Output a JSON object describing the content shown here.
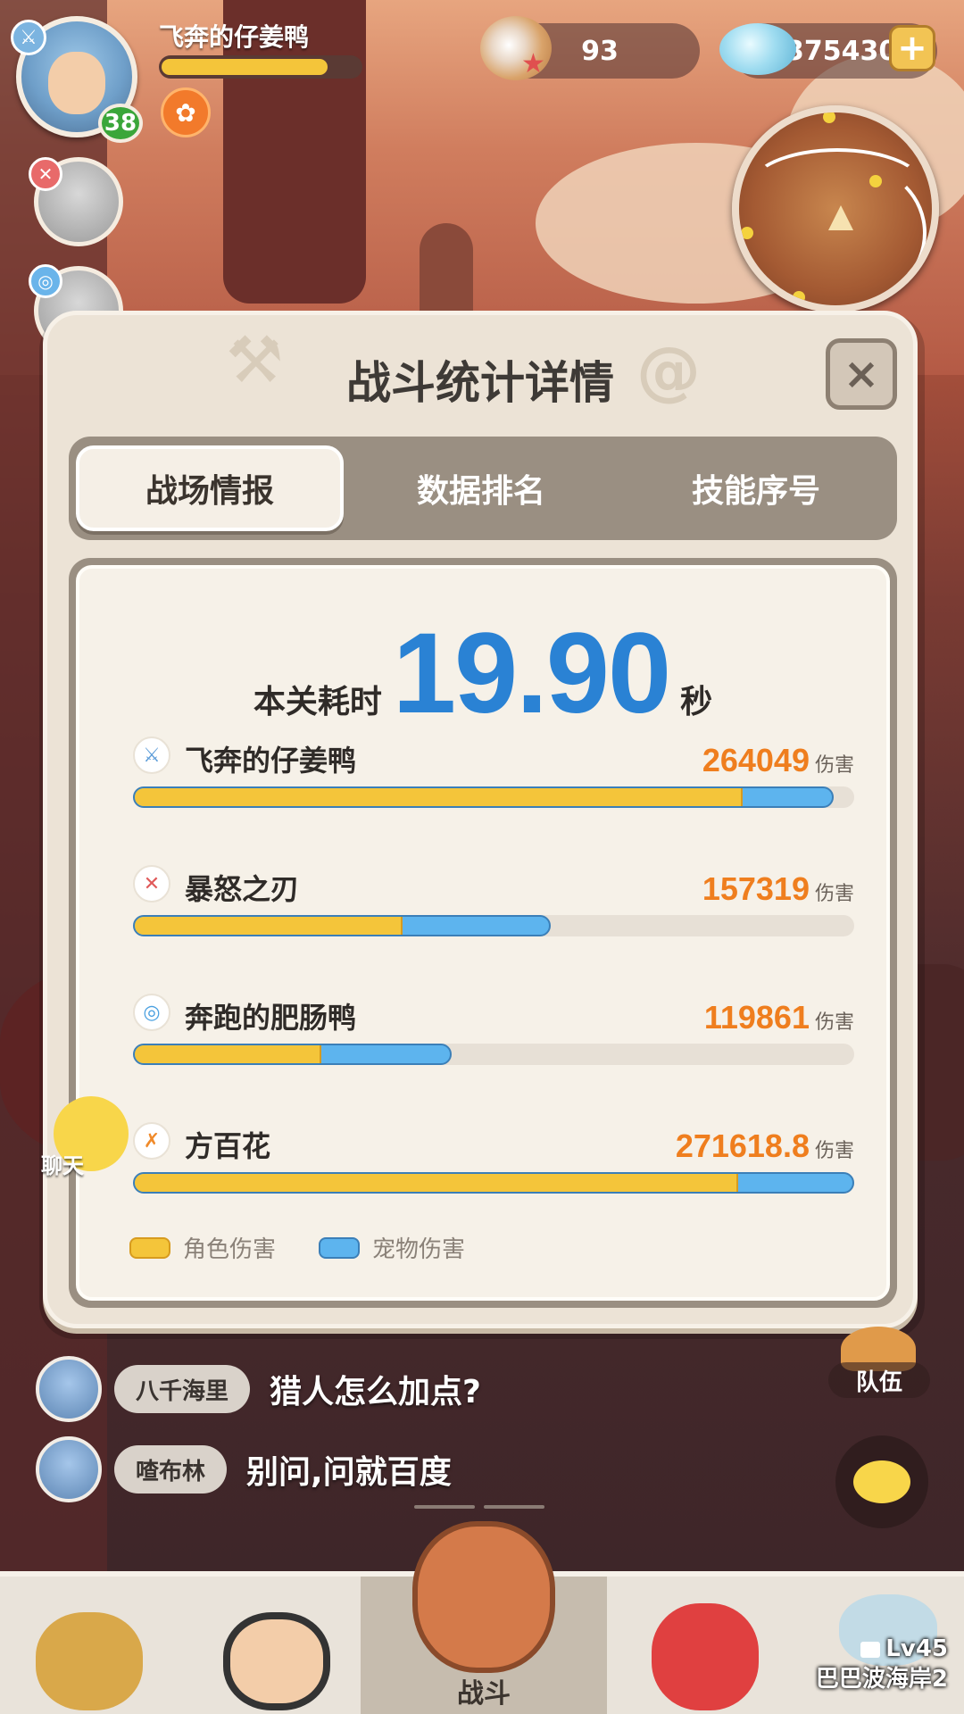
{
  "hud": {
    "player_name": "飞奔的仔姜鸭",
    "level": "38",
    "exp_fraction": 0.84,
    "pearl_count": "93",
    "shell_count": "375430",
    "plus_label": "+"
  },
  "modal": {
    "title": "战斗统计详情",
    "close_label": "×",
    "tabs": [
      {
        "label": "战场情报",
        "active": true
      },
      {
        "label": "数据排名",
        "active": false
      },
      {
        "label": "技能序号",
        "active": false
      }
    ],
    "time_label": "本关耗时",
    "time_value": "19.90",
    "time_unit": "秒",
    "damage_unit": "伤害",
    "legend": {
      "character_label": "角色伤害",
      "pet_label": "宠物伤害"
    }
  },
  "chart_data": {
    "type": "bar",
    "orientation": "horizontal",
    "stacked": true,
    "categories": [
      "飞奔的仔姜鸭",
      "暴怒之刃",
      "奔跑的肥肠鸭",
      "方百花"
    ],
    "totals": [
      264049,
      157319,
      119861,
      271618.8
    ],
    "total_labels": [
      "264049",
      "157319",
      "119861",
      "271618.8"
    ],
    "series": [
      {
        "name": "角色伤害",
        "color": "#f4c53a",
        "values": [
          229000,
          100800,
          70400,
          227200
        ]
      },
      {
        "name": "宠物伤害",
        "color": "#5db4ee",
        "values": [
          35049,
          56519,
          49461,
          44418.8
        ]
      }
    ],
    "xlim": [
      0,
      271618.8
    ],
    "legend_position": "bottom-left",
    "grid": false
  },
  "chat": {
    "toggle_label": "聊天",
    "messages": [
      {
        "user": "八千海里",
        "text": "猎人怎么加点?"
      },
      {
        "user": "喳布林",
        "text": "别问,问就百度"
      }
    ],
    "team_label": "队伍"
  },
  "bottom_nav": {
    "battle_label": "战斗",
    "locked_level": "Lv45",
    "locked_name": "巴巴波海岸2"
  },
  "colors": {
    "accent_blue": "#2a82d4",
    "damage_orange": "#ef7e1e",
    "character_yellow": "#f4c53a",
    "pet_blue": "#5db4ee",
    "level_green": "#3aa63a"
  }
}
